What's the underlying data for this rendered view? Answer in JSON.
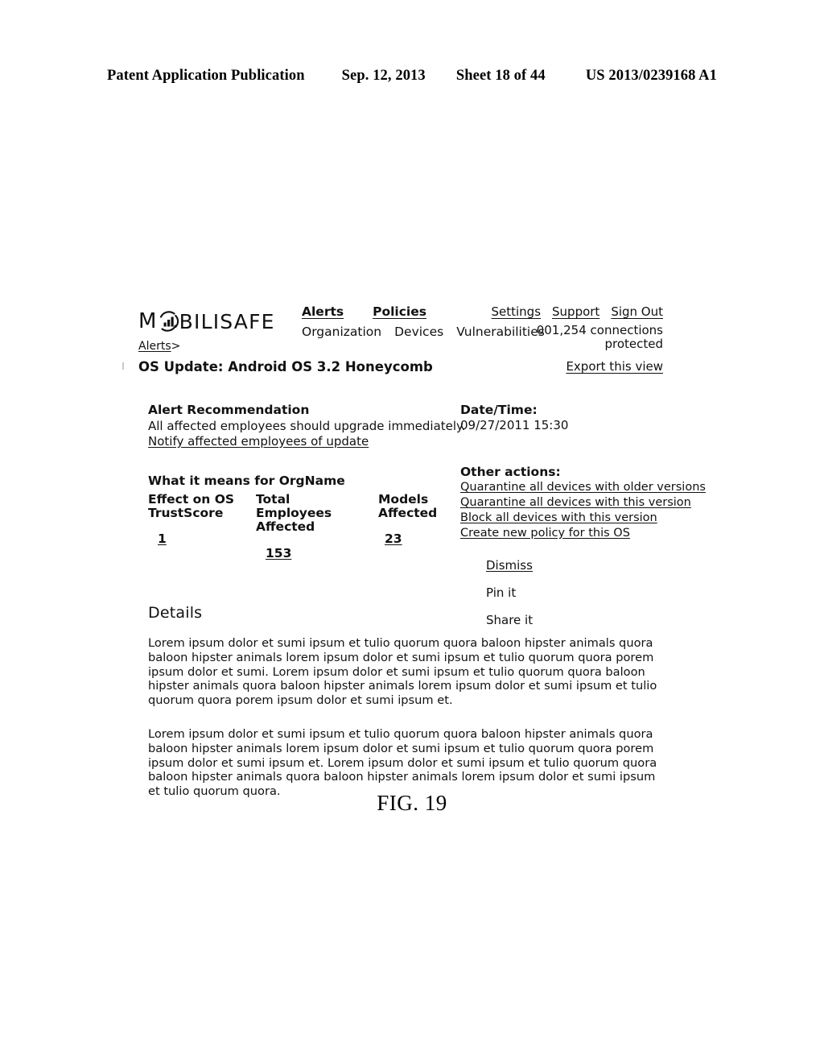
{
  "patent_header": {
    "publication": "Patent Application Publication",
    "date": "Sep. 12, 2013",
    "sheet": "Sheet 18 of 44",
    "number": "US 2013/0239168 A1"
  },
  "figure_caption": "FIG. 19",
  "app": {
    "logo": {
      "text_before": "M",
      "mark_icon": "bar-chart-orbit-icon",
      "text_after": "BILISAFE",
      "full_text": "MOBILISAFE"
    },
    "nav_primary": [
      {
        "label": "Alerts"
      },
      {
        "label": "Policies"
      }
    ],
    "nav_secondary": [
      {
        "label": "Organization"
      },
      {
        "label": "Devices"
      },
      {
        "label": "Vulnerabilities"
      }
    ],
    "nav_util": [
      {
        "label": "Settings"
      },
      {
        "label": "Support"
      },
      {
        "label": "Sign Out"
      }
    ],
    "connections": {
      "count": "001,254",
      "label_line1": "connections",
      "label_line2": "protected"
    },
    "breadcrumb": {
      "parent": "Alerts",
      "separator": ">"
    },
    "page_title": "OS Update: Android OS 3.2 Honeycomb",
    "export_link": "Export this view",
    "recommendation": {
      "heading": "Alert Recommendation",
      "text": "All affected employees should upgrade immediately.",
      "link": "Notify affected employees of update"
    },
    "datetime": {
      "label": "Date/Time:",
      "value": "09/27/2011 15:30"
    },
    "means": {
      "heading": "What it means for OrgName",
      "metrics": [
        {
          "label_line1": "Effect on OS",
          "label_line2": "TrustScore",
          "value": "1"
        },
        {
          "label_line1": "Total Employees",
          "label_line2": "Affected",
          "value": "153"
        },
        {
          "label_line1": "Models",
          "label_line2": "Affected",
          "value": "23"
        }
      ]
    },
    "other_actions": {
      "heading": "Other actions:",
      "items": [
        {
          "label": "Quarantine all devices with older versions"
        },
        {
          "label": "Quarantine all devices with this version"
        },
        {
          "label": "Block all devices with this version"
        },
        {
          "label": "Create new policy for this OS"
        }
      ]
    },
    "minor_actions": [
      {
        "label": "Dismiss",
        "underlined": true
      },
      {
        "label": "Pin it",
        "underlined": false
      },
      {
        "label": "Share it",
        "underlined": false
      }
    ],
    "details": {
      "heading": "Details",
      "paragraph_1": "Lorem ipsum dolor et sumi ipsum et tulio quorum quora baloon hipster animals quora baloon hipster animals lorem ipsum dolor et sumi ipsum et tulio quorum quora porem ipsum dolor et sumi. Lorem ipsum dolor et sumi ipsum et tulio quorum quora baloon hipster animals quora baloon hipster animals lorem ipsum dolor et sumi ipsum et tulio quorum quora porem ipsum dolor et sumi ipsum et.",
      "paragraph_2": "Lorem ipsum dolor et sumi ipsum et tulio quorum quora baloon hipster animals quora baloon hipster animals lorem ipsum dolor et sumi ipsum et tulio quorum quora porem ipsum dolor et sumi ipsum et. Lorem ipsum dolor et sumi ipsum et tulio quorum quora baloon hipster animals quora baloon hipster animals lorem ipsum dolor et sumi ipsum et tulio quorum quora."
    }
  }
}
